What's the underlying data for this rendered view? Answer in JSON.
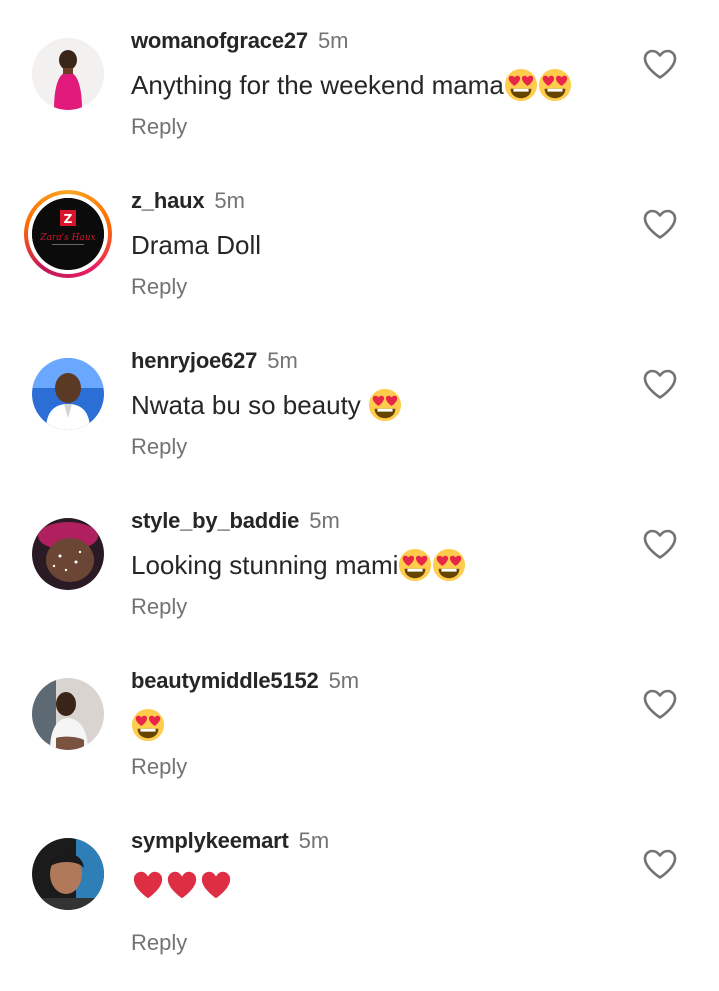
{
  "comments": [
    {
      "username": "womanofgrace27",
      "time": "5m",
      "text": "Anything for the weekend mama",
      "emojis": [
        "heart-eyes-emoji",
        "heart-eyes-emoji"
      ],
      "reply_label": "Reply"
    },
    {
      "username": "z_haux",
      "time": "5m",
      "text": "Drama Doll",
      "emojis": [],
      "reply_label": "Reply",
      "has_story_ring": true
    },
    {
      "username": "henryjoe627",
      "time": "5m",
      "text": "Nwata bu so beauty ",
      "emojis": [
        "heart-eyes-emoji"
      ],
      "reply_label": "Reply"
    },
    {
      "username": "style_by_baddie",
      "time": "5m",
      "text": "Looking stunning mami",
      "emojis": [
        "heart-eyes-emoji",
        "heart-eyes-emoji"
      ],
      "reply_label": "Reply"
    },
    {
      "username": "beautymiddle5152",
      "time": "5m",
      "text": "",
      "emojis": [
        "heart-eyes-emoji"
      ],
      "reply_label": "Reply"
    },
    {
      "username": "symplykeemart",
      "time": "5m",
      "text": "",
      "emojis": [
        "red-heart-emoji",
        "red-heart-emoji",
        "red-heart-emoji"
      ],
      "reply_label": "Reply"
    }
  ],
  "icons": {
    "like": "heart-outline-icon"
  },
  "colors": {
    "username": "#262626",
    "muted": "#737373",
    "story_ring": "#e91e63"
  }
}
